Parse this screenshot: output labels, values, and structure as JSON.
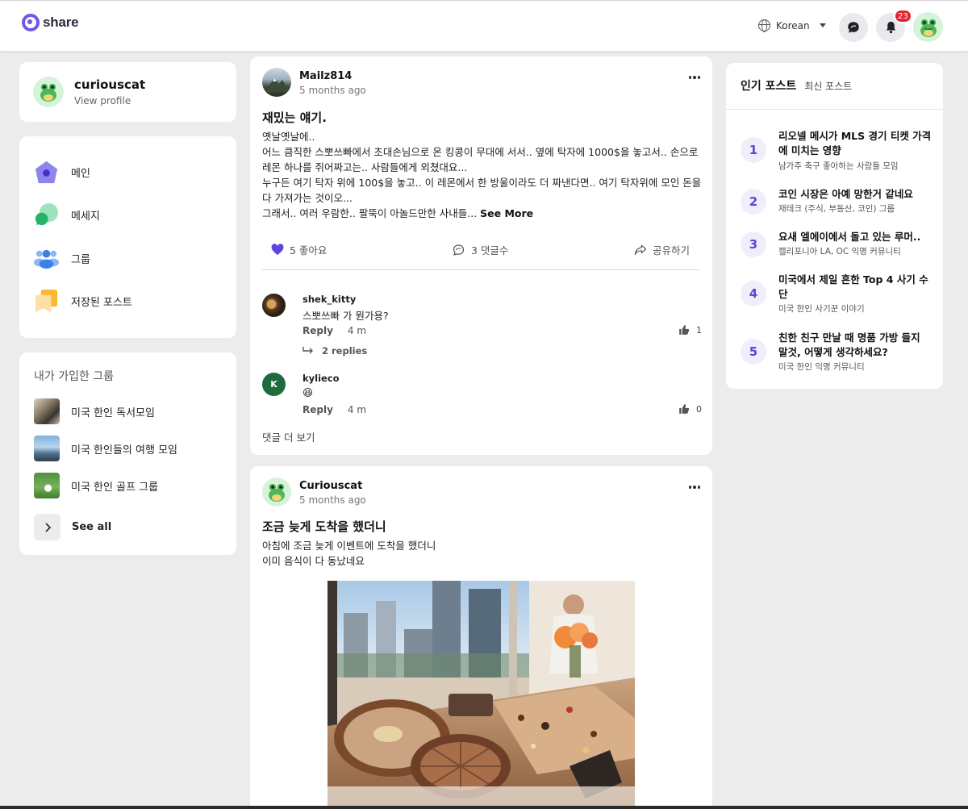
{
  "header": {
    "logo_text": "share",
    "language": "Korean",
    "notification_count": "23"
  },
  "profile": {
    "name": "curiouscat",
    "view_profile": "View profile"
  },
  "nav": {
    "items": [
      {
        "label": "메인"
      },
      {
        "label": "메세지"
      },
      {
        "label": "그룹"
      },
      {
        "label": "저장된 포스트"
      }
    ]
  },
  "groups": {
    "title": "내가 가입한 그룹",
    "items": [
      {
        "label": "미국 한인 독서모임"
      },
      {
        "label": "미국 한인들의 여행 모임"
      },
      {
        "label": "미국 한인 골프 그룹"
      }
    ],
    "see_all": "See all"
  },
  "posts": [
    {
      "author": "Mailz814",
      "time": "5 months ago",
      "title": "재밌는 얘기.",
      "body_lines": [
        "옛날옛날에..",
        "어느 큼직한 스뽀쓰빠에서 초대손님으로 온 킹콩이 무대에 서서.. 옆에 탁자에 1000$을 놓고서.. 손으로",
        "레몬 하나를 쥐어짜고는.. 사람들에게 외쳤대요...",
        "누구든 여기 탁자 위에 100$을 놓고.. 이 레몬에서 한 방울이라도 더 짜낸다면.. 여기 탁자위에 모인 돈을",
        "다 가져가는 것이오...",
        "그래서.. 여러 우람한.. 팔뚝이 아놀드만한 사내들..."
      ],
      "see_more": "See More",
      "likes": "5 좋아요",
      "comments_count": "3 댓글수",
      "share": "공유하기",
      "comments": [
        {
          "name": "shek_kitty",
          "text": "스뽀쓰빠 가 뭔가용?",
          "reply": "Reply",
          "time": "4 m",
          "likes": "1",
          "replies": "2 replies"
        },
        {
          "name": "kylieco",
          "avatar_letter": "K",
          "text": "😆",
          "reply": "Reply",
          "time": "4 m",
          "likes": "0"
        }
      ],
      "more_comments": "댓글 더 보기"
    },
    {
      "author": "Curiouscat",
      "time": "5 months ago",
      "title": "조금 늦게 도착을 했더니",
      "body_lines": [
        "아침에 조금 늦게 이벤트에 도착을 했더니",
        "이미 음식이 다 동났네요"
      ]
    }
  ],
  "popular": {
    "tab_active": "인기 포스트",
    "tab_other": "최신 포스트",
    "items": [
      {
        "rank": "1",
        "title": " 리오넬 메시가 MLS 경기 티켓 가격에 미치는 영향",
        "group": "남가주 축구 좋아하는 사람들 모임"
      },
      {
        "rank": "2",
        "title": "코인 시장은 아예 망한거 같네요",
        "group": "재테크 (주식, 부동산, 코인) 그룹"
      },
      {
        "rank": "3",
        "title": "요새 엘에이에서 돌고 있는 루머..",
        "group": "캘리포니아 LA, OC 익명 커뮤니티"
      },
      {
        "rank": "4",
        "title": "미국에서 제일 흔한 Top 4 사기 수단",
        "group": "미국 한인 사기꾼 이야기"
      },
      {
        "rank": "5",
        "title": "친한 친구 만날 때 명품 가방 들지 말것, 어떻게 생각하세요?",
        "group": "미국 한인 익명 커뮤니티"
      }
    ]
  },
  "colors": {
    "accent": "#6f58e9",
    "badge": "#e2262f",
    "like_heart": "#5b47e0"
  }
}
